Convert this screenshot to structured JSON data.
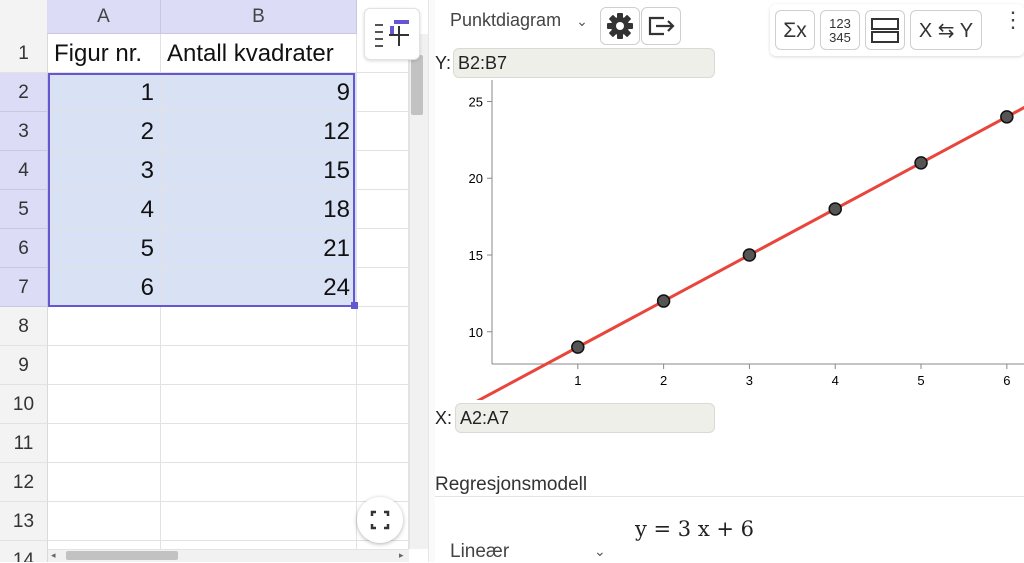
{
  "spreadsheet": {
    "columns": [
      "A",
      "B"
    ],
    "rows": [
      {
        "num": "1",
        "a": "Figur nr.",
        "b": "Antall kvadrater"
      },
      {
        "num": "2",
        "a": "1",
        "b": "9"
      },
      {
        "num": "3",
        "a": "2",
        "b": "12"
      },
      {
        "num": "4",
        "a": "3",
        "b": "15"
      },
      {
        "num": "5",
        "a": "4",
        "b": "18"
      },
      {
        "num": "6",
        "a": "5",
        "b": "21"
      },
      {
        "num": "7",
        "a": "6",
        "b": "24"
      },
      {
        "num": "8",
        "a": "",
        "b": ""
      },
      {
        "num": "9",
        "a": "",
        "b": ""
      },
      {
        "num": "10",
        "a": "",
        "b": ""
      },
      {
        "num": "11",
        "a": "",
        "b": ""
      },
      {
        "num": "12",
        "a": "",
        "b": ""
      },
      {
        "num": "13",
        "a": "",
        "b": ""
      },
      {
        "num": "14",
        "a": "",
        "b": ""
      }
    ],
    "selection_color": "#6557d2"
  },
  "analysis": {
    "plot_type": "Punktdiagram",
    "toolbar": {
      "sum_label": "Σx",
      "stats_top": "123",
      "stats_bottom": "345",
      "swap_label": "X ⇆ Y"
    },
    "y_label": "Y:",
    "y_range": "B2:B7",
    "x_label": "X:",
    "x_range": "A2:A7",
    "regression_heading": "Regresjonsmodell",
    "regression_type": "Lineær",
    "regression_formula": "y = 3 x + 6"
  },
  "chart_data": {
    "type": "scatter",
    "x": [
      1,
      2,
      3,
      4,
      5,
      6
    ],
    "y": [
      9,
      12,
      15,
      18,
      21,
      24
    ],
    "xticks": [
      1,
      2,
      3,
      4,
      5,
      6
    ],
    "yticks": [
      10,
      15,
      20,
      25
    ],
    "xlim": [
      0.0,
      6.2
    ],
    "ylim": [
      7.9,
      26.4
    ],
    "regression": {
      "slope": 3,
      "intercept": 6
    },
    "point_color": "#555555",
    "line_color": "#e8453c"
  }
}
